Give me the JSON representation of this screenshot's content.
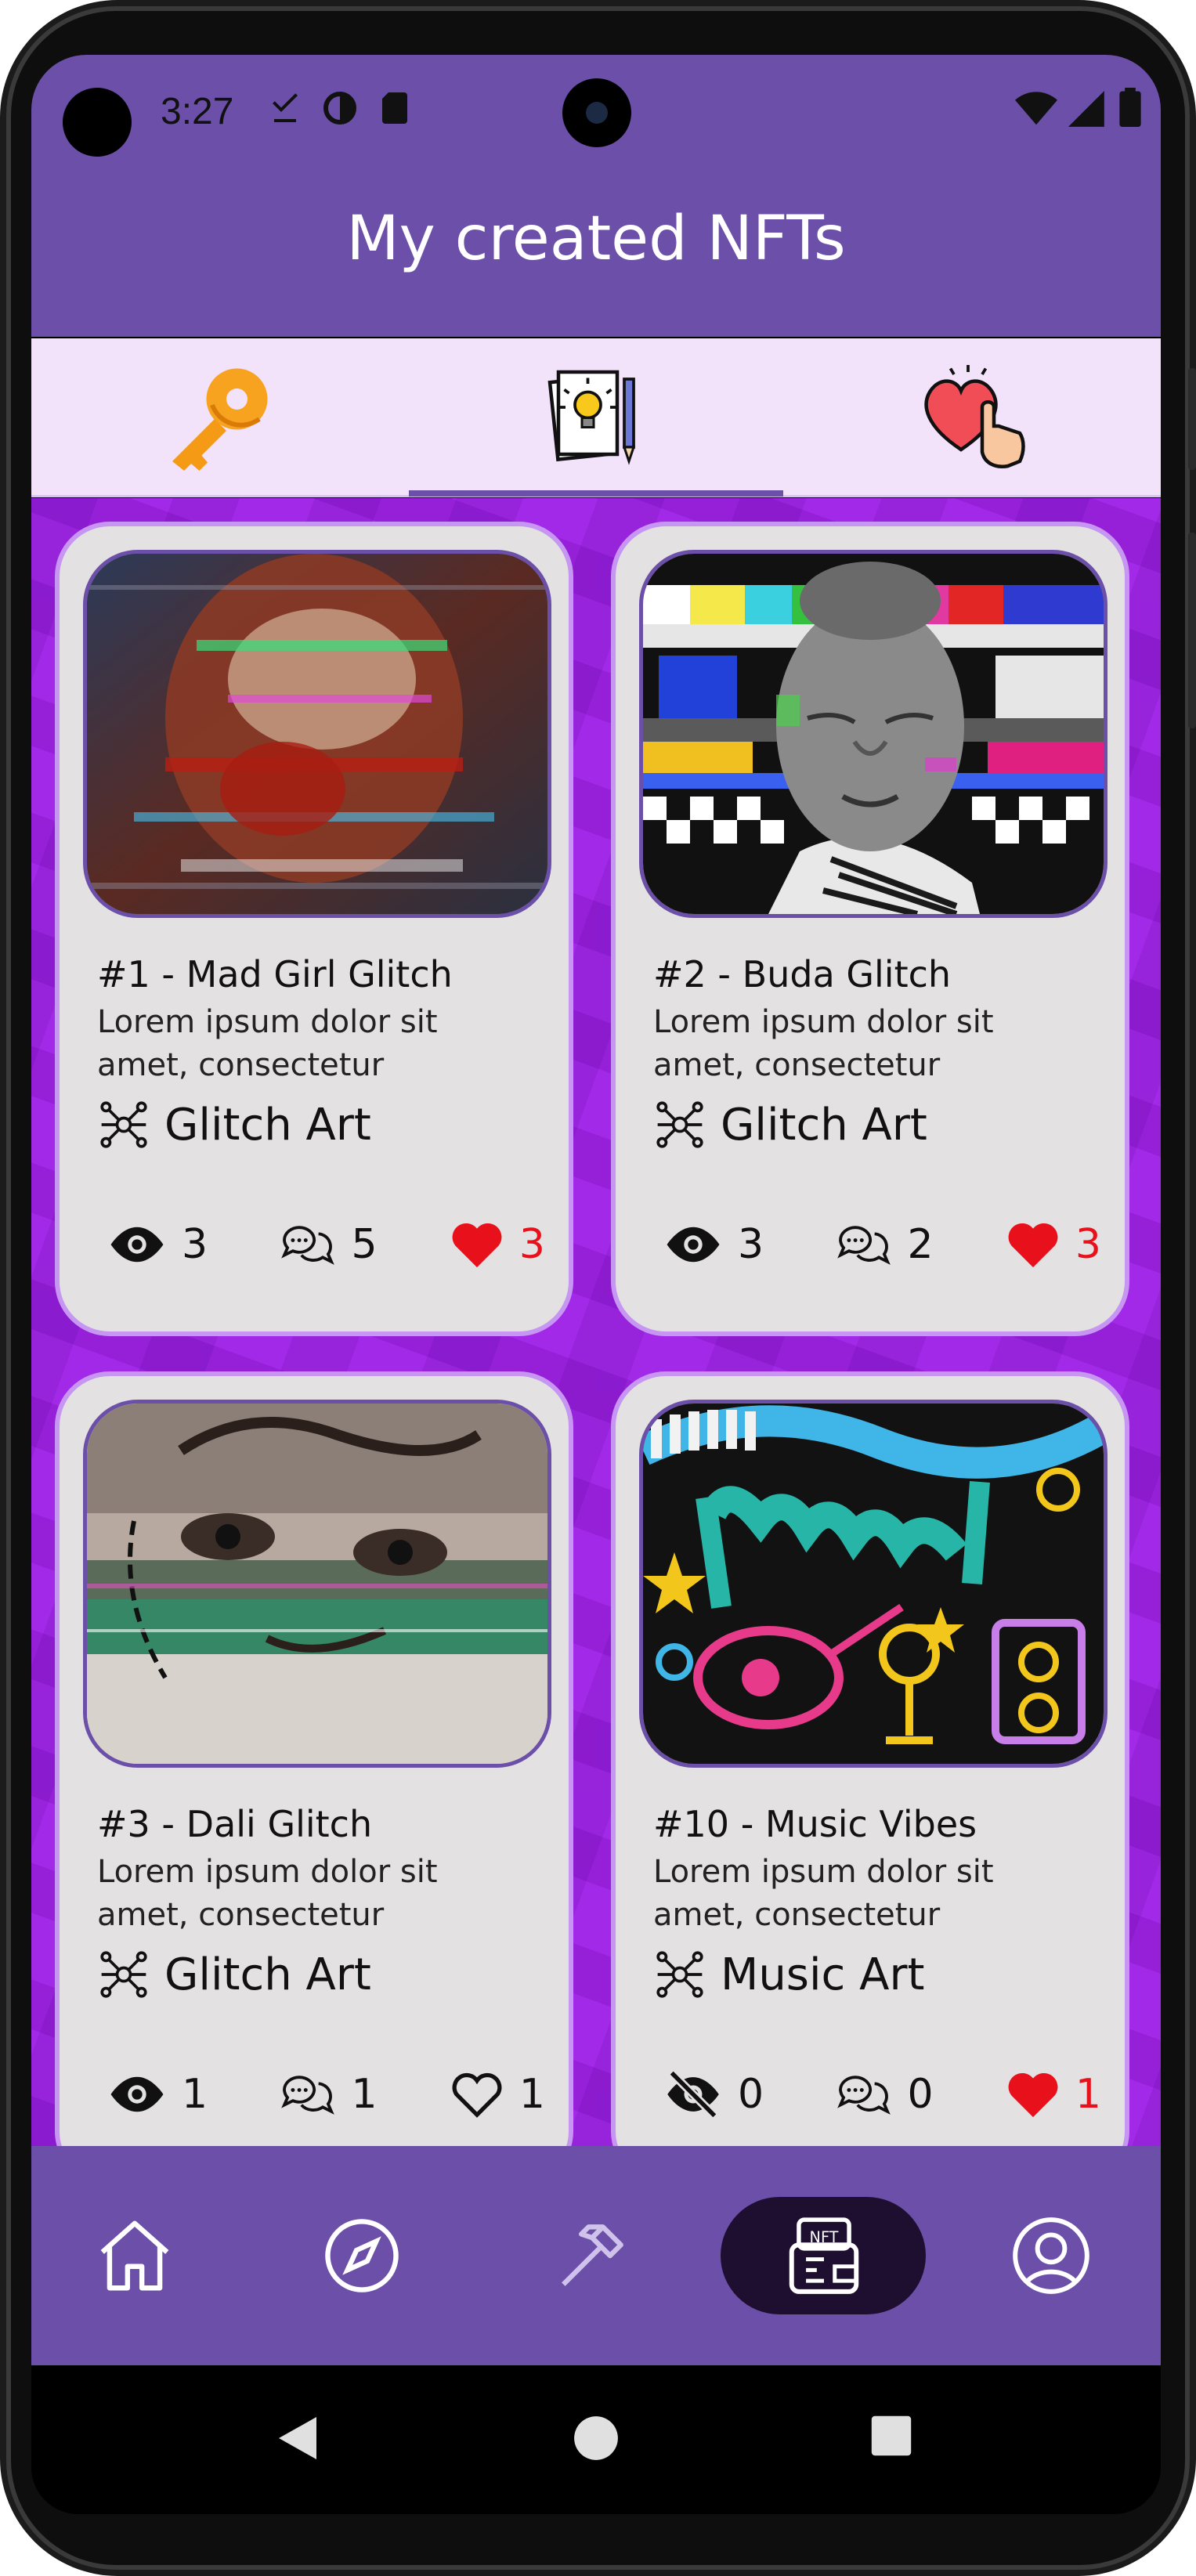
{
  "status_bar": {
    "time": "3:27"
  },
  "app_bar": {
    "title": "My created NFTs"
  },
  "tabs": [
    {
      "name": "key-icon",
      "selected": false
    },
    {
      "name": "ideas-icon",
      "selected": true
    },
    {
      "name": "liked-icon",
      "selected": false
    }
  ],
  "cards": [
    {
      "title": "#1 - Mad Girl Glitch",
      "description": "Lorem ipsum dolor sit amet, consectetur",
      "category": "Glitch Art",
      "views": "3",
      "comments": "5",
      "likes": "3",
      "liked": true,
      "views_hidden": false
    },
    {
      "title": "#2 - Buda Glitch",
      "description": "Lorem ipsum dolor sit amet, consectetur",
      "category": "Glitch Art",
      "views": "3",
      "comments": "2",
      "likes": "3",
      "liked": true,
      "views_hidden": false
    },
    {
      "title": "#3 - Dali Glitch",
      "description": "Lorem ipsum dolor sit amet, consectetur",
      "category": "Glitch Art",
      "views": "1",
      "comments": "1",
      "likes": "1",
      "liked": false,
      "views_hidden": false
    },
    {
      "title": "#10 - Music Vibes",
      "description": "Lorem ipsum dolor sit amet, consectetur",
      "category": "Music Art",
      "views": "0",
      "comments": "0",
      "likes": "1",
      "liked": true,
      "views_hidden": true
    }
  ],
  "bottom_nav": [
    {
      "name": "home-icon",
      "active": false
    },
    {
      "name": "explore-icon",
      "active": false
    },
    {
      "name": "create-hammer-icon",
      "active": false
    },
    {
      "name": "nft-wallet-icon",
      "active": true
    },
    {
      "name": "profile-icon",
      "active": false
    }
  ],
  "colors": {
    "primary": "#6b4fa8",
    "tab_bg": "#f2e3fb",
    "content_bg": "#9c1ee6",
    "card_bg": "#e3e1e2",
    "like_red": "#e8111b"
  }
}
